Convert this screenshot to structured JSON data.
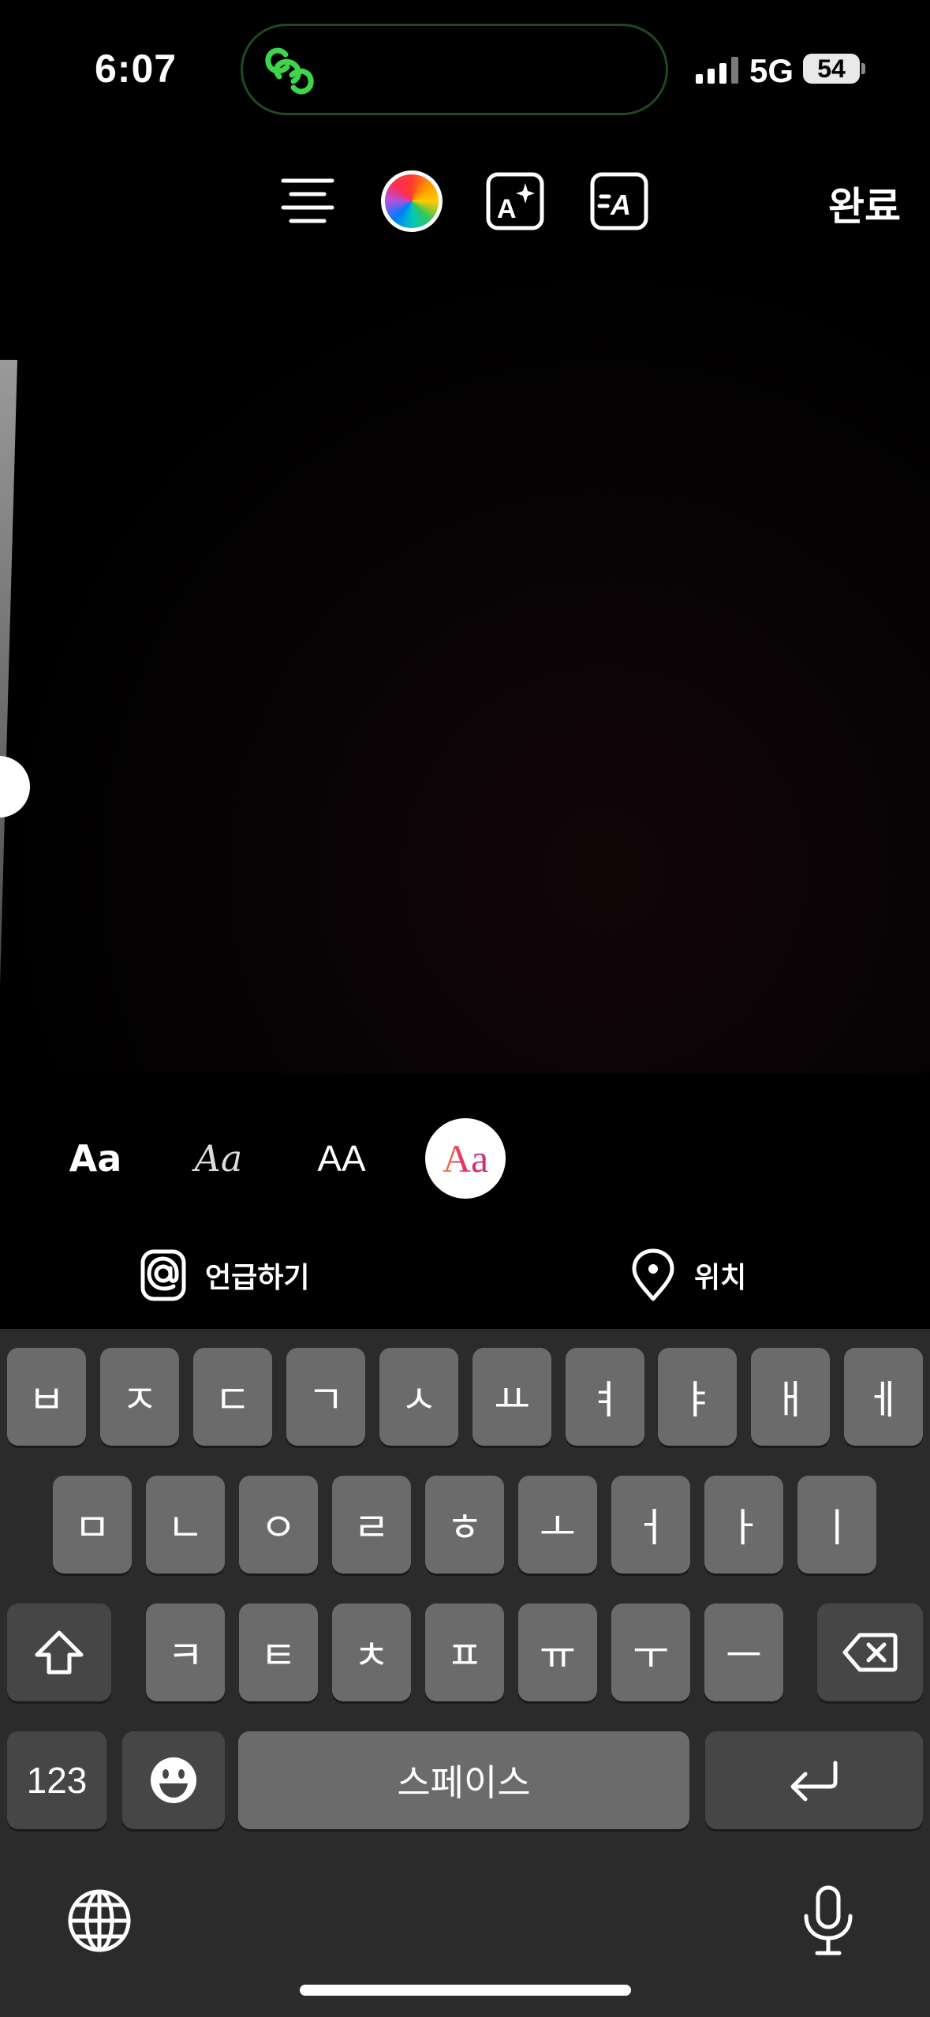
{
  "status": {
    "time": "6:07",
    "network": "5G",
    "battery": "54"
  },
  "toolbar": {
    "align_icon": "align-center-icon",
    "color_icon": "color-wheel-icon",
    "effect_icon": "text-effect-icon",
    "animate_icon": "text-animate-icon",
    "done_label": "완료"
  },
  "fonts": [
    {
      "label": "Aa"
    },
    {
      "label": "Aa"
    },
    {
      "label": "AA"
    },
    {
      "label": "Aa"
    }
  ],
  "actions": {
    "mention_label": "언급하기",
    "location_label": "위치"
  },
  "keyboard": {
    "row1": [
      "ㅂ",
      "ㅈ",
      "ㄷ",
      "ㄱ",
      "ㅅ",
      "ㅛ",
      "ㅕ",
      "ㅑ",
      "ㅐ",
      "ㅔ"
    ],
    "row2": [
      "ㅁ",
      "ㄴ",
      "ㅇ",
      "ㄹ",
      "ㅎ",
      "ㅗ",
      "ㅓ",
      "ㅏ",
      "ㅣ"
    ],
    "row3": [
      "ㅋ",
      "ㅌ",
      "ㅊ",
      "ㅍ",
      "ㅠ",
      "ㅜ",
      "ㅡ"
    ],
    "numbers_label": "123",
    "space_label": "스페이스"
  }
}
